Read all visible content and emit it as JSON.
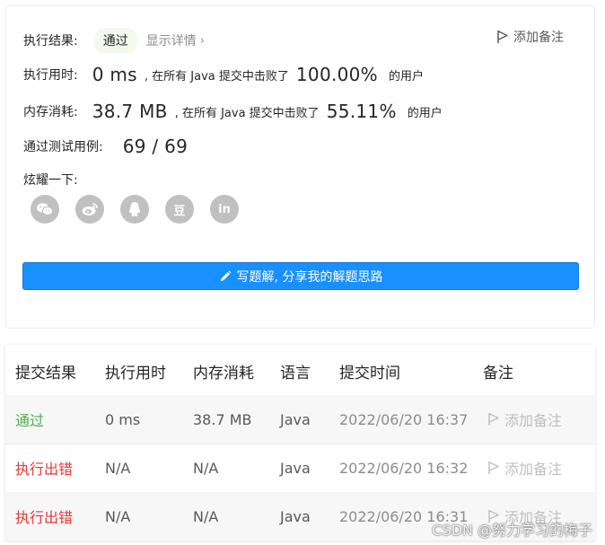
{
  "result": {
    "label": "执行结果:",
    "status": "通过",
    "details_link": "显示详情",
    "add_note": "添加备注"
  },
  "runtime": {
    "label": "执行用时:",
    "value": "0 ms",
    "beat_text": ", 在所有 Java 提交中击败了",
    "percent": "100.00%",
    "users": "的用户"
  },
  "memory": {
    "label": "内存消耗:",
    "value": "38.7 MB",
    "beat_text": ", 在所有 Java 提交中击败了",
    "percent": "55.11%",
    "users": "的用户"
  },
  "tests": {
    "label": "通过测试用例:",
    "value": "69 / 69"
  },
  "share": {
    "label": "炫耀一下:",
    "icons": [
      "wechat-icon",
      "weibo-icon",
      "qq-icon",
      "douban-icon",
      "linkedin-icon"
    ],
    "douban_glyph": "豆",
    "linkedin_glyph": "in"
  },
  "write_button": "写题解, 分享我的解题思路",
  "table": {
    "headers": [
      "提交结果",
      "执行用时",
      "内存消耗",
      "语言",
      "提交时间",
      "备注"
    ],
    "rows": [
      {
        "result": "通过",
        "runtime": "0 ms",
        "memory": "38.7 MB",
        "lang": "Java",
        "time": "2022/06/20 16:37",
        "note": "添加备注"
      },
      {
        "result": "执行出错",
        "runtime": "N/A",
        "memory": "N/A",
        "lang": "Java",
        "time": "2022/06/20 16:32",
        "note": "添加备注"
      },
      {
        "result": "执行出错",
        "runtime": "N/A",
        "memory": "N/A",
        "lang": "Java",
        "time": "2022/06/20 16:31",
        "note": "添加备注"
      }
    ]
  },
  "colors": {
    "accent": "#1890ff",
    "success": "#4caf50",
    "error": "#e53935"
  },
  "watermark": "CSDN @努力学习的梅子"
}
